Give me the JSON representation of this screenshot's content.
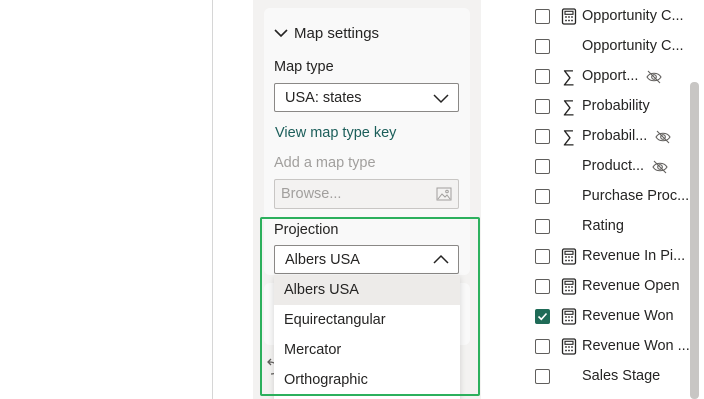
{
  "map_settings": {
    "header": "Map settings",
    "map_type_label": "Map type",
    "map_type_value": "USA: states",
    "view_key_link": "View map type key",
    "add_map_type_label": "Add a map type",
    "browse_placeholder": "Browse...",
    "projection_label": "Projection",
    "projection_value": "Albers USA",
    "projection_options": [
      "Albers USA",
      "Equirectangular",
      "Mercator",
      "Orthographic"
    ]
  },
  "fields": [
    {
      "name": "Opportunity C...",
      "icon": "calculator-icon",
      "checked": false,
      "hidden": false
    },
    {
      "name": "Opportunity C...",
      "icon": "none",
      "checked": false,
      "hidden": false
    },
    {
      "name": "Opport...",
      "icon": "sigma-icon",
      "checked": false,
      "hidden": true
    },
    {
      "name": "Probability",
      "icon": "sigma-icon",
      "checked": false,
      "hidden": false
    },
    {
      "name": "Probabil...",
      "icon": "sigma-icon",
      "checked": false,
      "hidden": true
    },
    {
      "name": "Product...",
      "icon": "none",
      "checked": false,
      "hidden": true
    },
    {
      "name": "Purchase Proc...",
      "icon": "none",
      "checked": false,
      "hidden": false
    },
    {
      "name": "Rating",
      "icon": "none",
      "checked": false,
      "hidden": false
    },
    {
      "name": "Revenue In Pi...",
      "icon": "calculator-icon",
      "checked": false,
      "hidden": false
    },
    {
      "name": "Revenue Open",
      "icon": "calculator-icon",
      "checked": false,
      "hidden": false
    },
    {
      "name": "Revenue Won",
      "icon": "calculator-icon",
      "checked": true,
      "hidden": false
    },
    {
      "name": "Revenue Won ...",
      "icon": "calculator-icon",
      "checked": false,
      "hidden": false
    },
    {
      "name": "Sales Stage",
      "icon": "none",
      "checked": false,
      "hidden": false
    }
  ],
  "colors": {
    "accent_link": "#1b5e5a",
    "highlight_border": "#2cb05d",
    "checkbox_checked": "#1f6b57"
  }
}
